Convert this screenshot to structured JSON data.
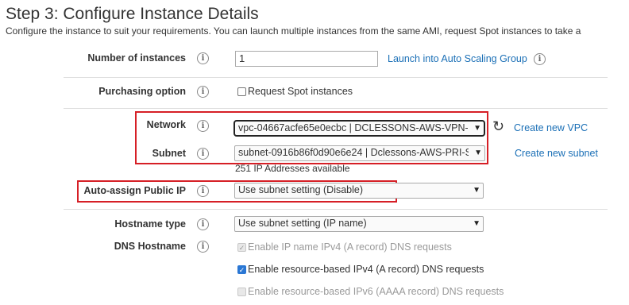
{
  "header": {
    "title": "Step 3: Configure Instance Details",
    "subtitle": "Configure the instance to suit your requirements. You can launch multiple instances from the same AMI, request Spot instances to take a"
  },
  "info_glyph": "i",
  "rows": {
    "num_instances": {
      "label": "Number of instances",
      "value": "1",
      "link": "Launch into Auto Scaling Group"
    },
    "purchasing": {
      "label": "Purchasing option",
      "checkbox_label": "Request Spot instances",
      "checked": false
    },
    "network": {
      "label": "Network",
      "value": "vpc-04667acfe65e0ecbc | DCLESSONS-AWS-VPN-",
      "link": "Create new VPC"
    },
    "subnet": {
      "label": "Subnet",
      "value": "subnet-0916b86f0d90e6e24 | Dclessons-AWS-PRI-S",
      "link": "Create new subnet",
      "note": "251 IP Addresses available"
    },
    "public_ip": {
      "label": "Auto-assign Public IP",
      "value": "Use subnet setting (Disable)"
    },
    "hostname_type": {
      "label": "Hostname type",
      "value": "Use subnet setting (IP name)"
    },
    "dns_hostname": {
      "label": "DNS Hostname",
      "options": [
        {
          "label": "Enable IP name IPv4 (A record) DNS requests",
          "checked": true,
          "disabled": true
        },
        {
          "label": "Enable resource-based IPv4 (A record) DNS requests",
          "checked": true,
          "disabled": false
        },
        {
          "label": "Enable resource-based IPv6 (AAAA record) DNS requests",
          "checked": false,
          "disabled": true
        }
      ]
    }
  },
  "icons": {
    "dropdown": "dropdown-arrow-icon",
    "refresh": "refresh-icon",
    "info": "info-icon"
  },
  "colors": {
    "link": "#1a6fb6",
    "highlight_box": "#d61f26",
    "checkbox_checked": "#2a77d4"
  }
}
